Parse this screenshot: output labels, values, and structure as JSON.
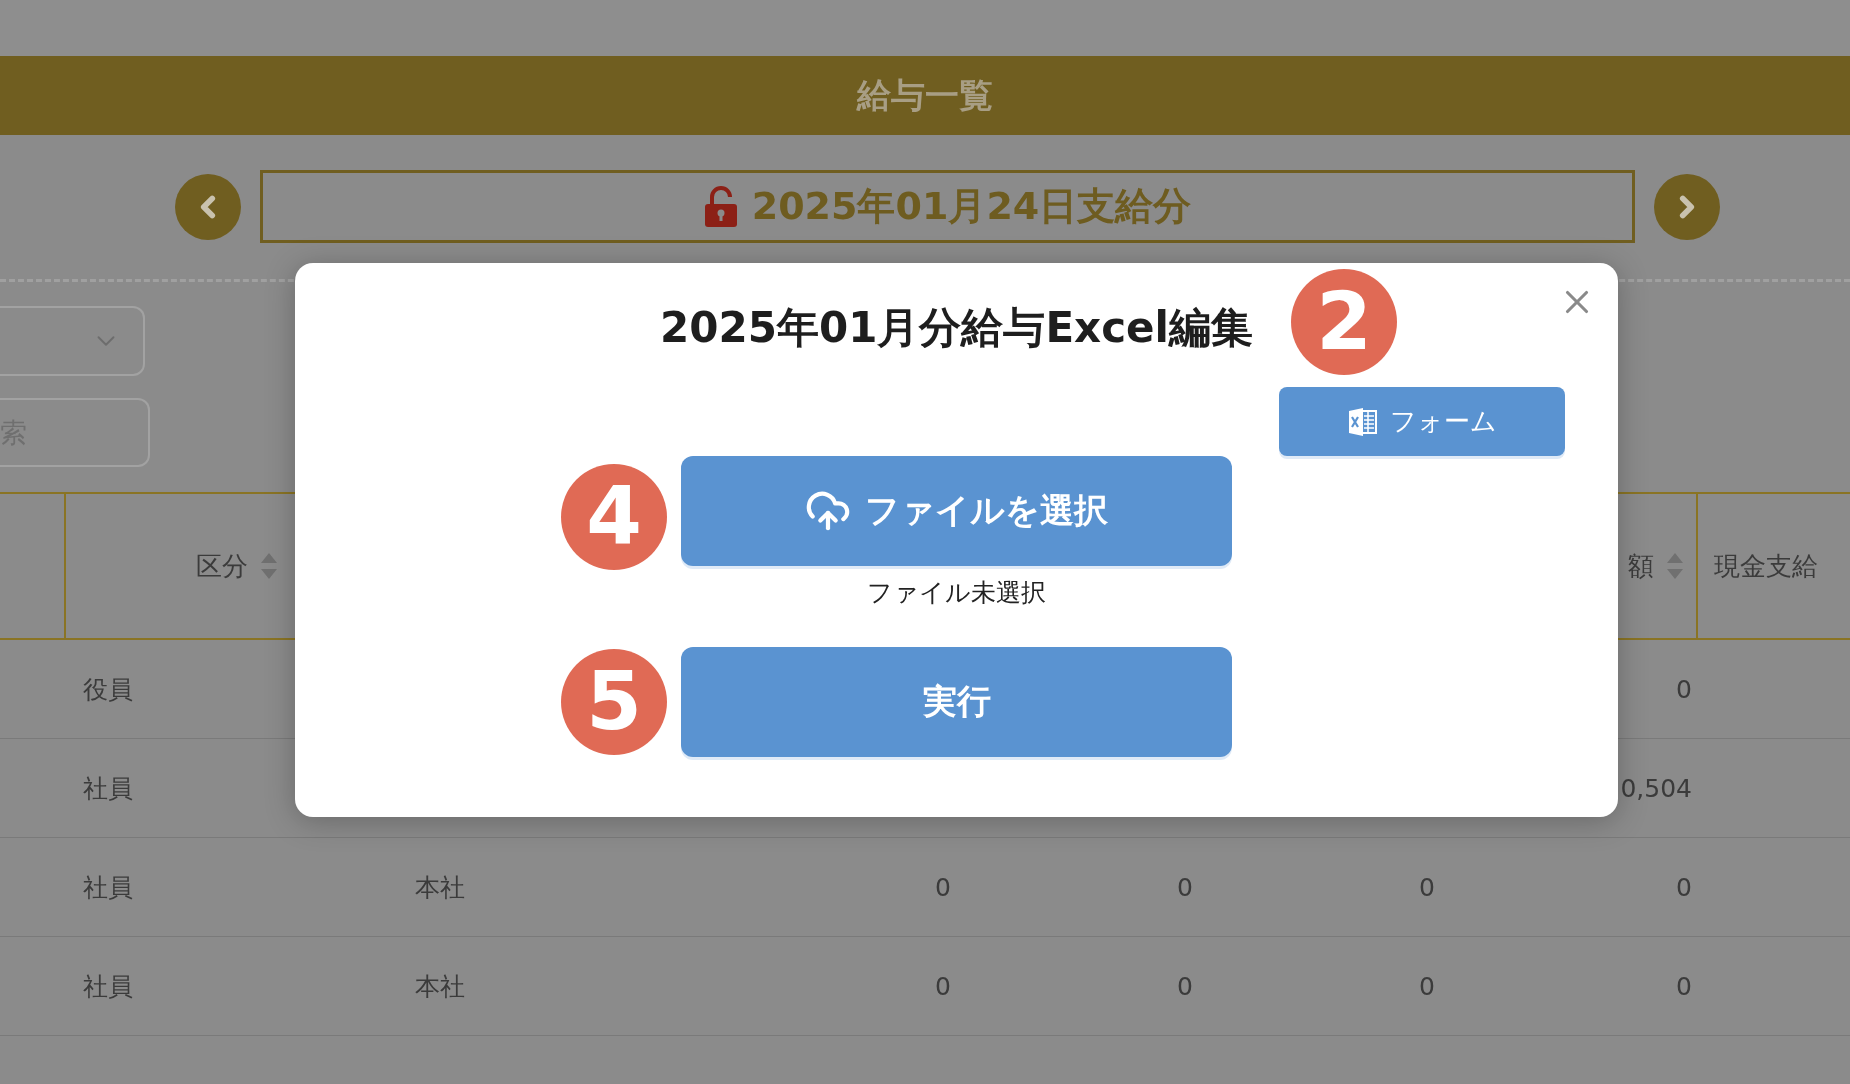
{
  "page_title": "給与一覧",
  "period": {
    "label": "2025年01月24日支給分",
    "locked": false
  },
  "search": {
    "placeholder": "索"
  },
  "table": {
    "columns": [
      {
        "label": "区分",
        "sortable": true
      },
      {
        "label": "額",
        "sortable": true
      },
      {
        "label": "現金支給"
      }
    ],
    "rows": [
      {
        "category": "役員",
        "amount": "0"
      },
      {
        "category": "社員",
        "amount": "0,504"
      },
      {
        "category": "社員",
        "column_3": "本社",
        "column_4": "0",
        "column_5": "0",
        "column_6": "0",
        "amount": "0"
      },
      {
        "category": "社員",
        "column_3": "本社",
        "column_4": "0",
        "column_5": "0",
        "column_6": "0",
        "amount": "0"
      }
    ]
  },
  "dialog": {
    "title": "2025年01月分給与Excel編集",
    "form_button": {
      "label": "フォーム",
      "marker": "2"
    },
    "file_button": {
      "label": "ファイルを選択",
      "marker": "4"
    },
    "file_status": "ファイル未選択",
    "run_button": {
      "label": "実行",
      "marker": "5"
    }
  }
}
